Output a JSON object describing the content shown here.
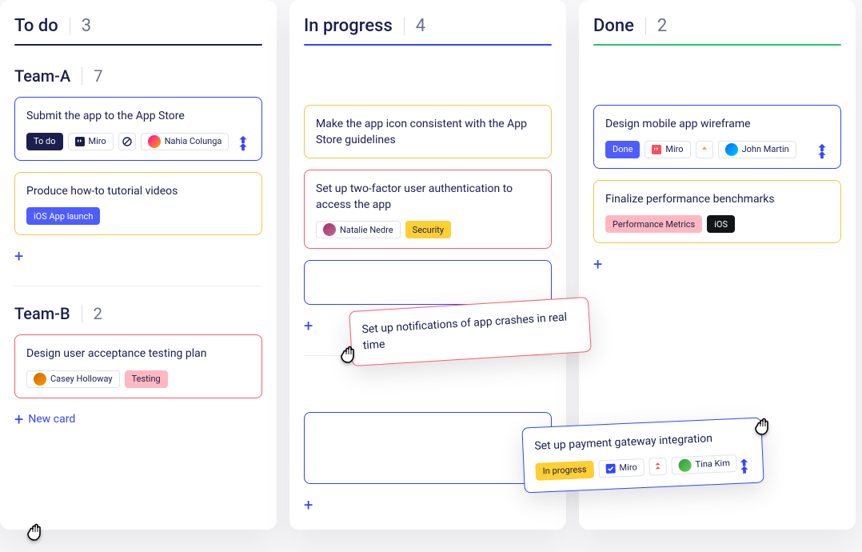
{
  "columns": {
    "todo": {
      "title": "To do",
      "count": 3
    },
    "progress": {
      "title": "In progress",
      "count": 4
    },
    "done": {
      "title": "Done",
      "count": 2
    }
  },
  "swimlanes": {
    "a": {
      "title": "Team-A",
      "count": 7
    },
    "b": {
      "title": "Team-B",
      "count": 2
    }
  },
  "cards": {
    "c1": {
      "title": "Submit the app to the App Store",
      "status": "To do",
      "toolChip": "Miro",
      "assignee": "Nahia Colunga"
    },
    "c2": {
      "title": "Produce how-to tutorial videos",
      "tag": "iOS App launch"
    },
    "c3": {
      "title": "Design user acceptance testing plan",
      "assignee": "Casey Holloway",
      "tag": "Testing"
    },
    "c4": {
      "title": "Make the app icon consistent with the App Store guidelines"
    },
    "c5": {
      "title": "Set up two-factor user authentication to access the app",
      "assignee": "Natalie Nedre",
      "tag": "Security"
    },
    "c6": {
      "title": "Set up notifications of app crashes in real time"
    },
    "c7": {
      "title": "Set up payment gateway integration",
      "status": "In progress",
      "toolChip": "Miro",
      "assignee": "Tina Kim"
    },
    "c8": {
      "title": "Design mobile app wireframe",
      "status": "Done",
      "toolChip": "Miro",
      "assignee": "John Martin"
    },
    "c9": {
      "title": "Finalize performance benchmarks",
      "tag1": "Performance Metrics",
      "tag2": "iOS"
    }
  },
  "labels": {
    "newCard": "New card"
  }
}
